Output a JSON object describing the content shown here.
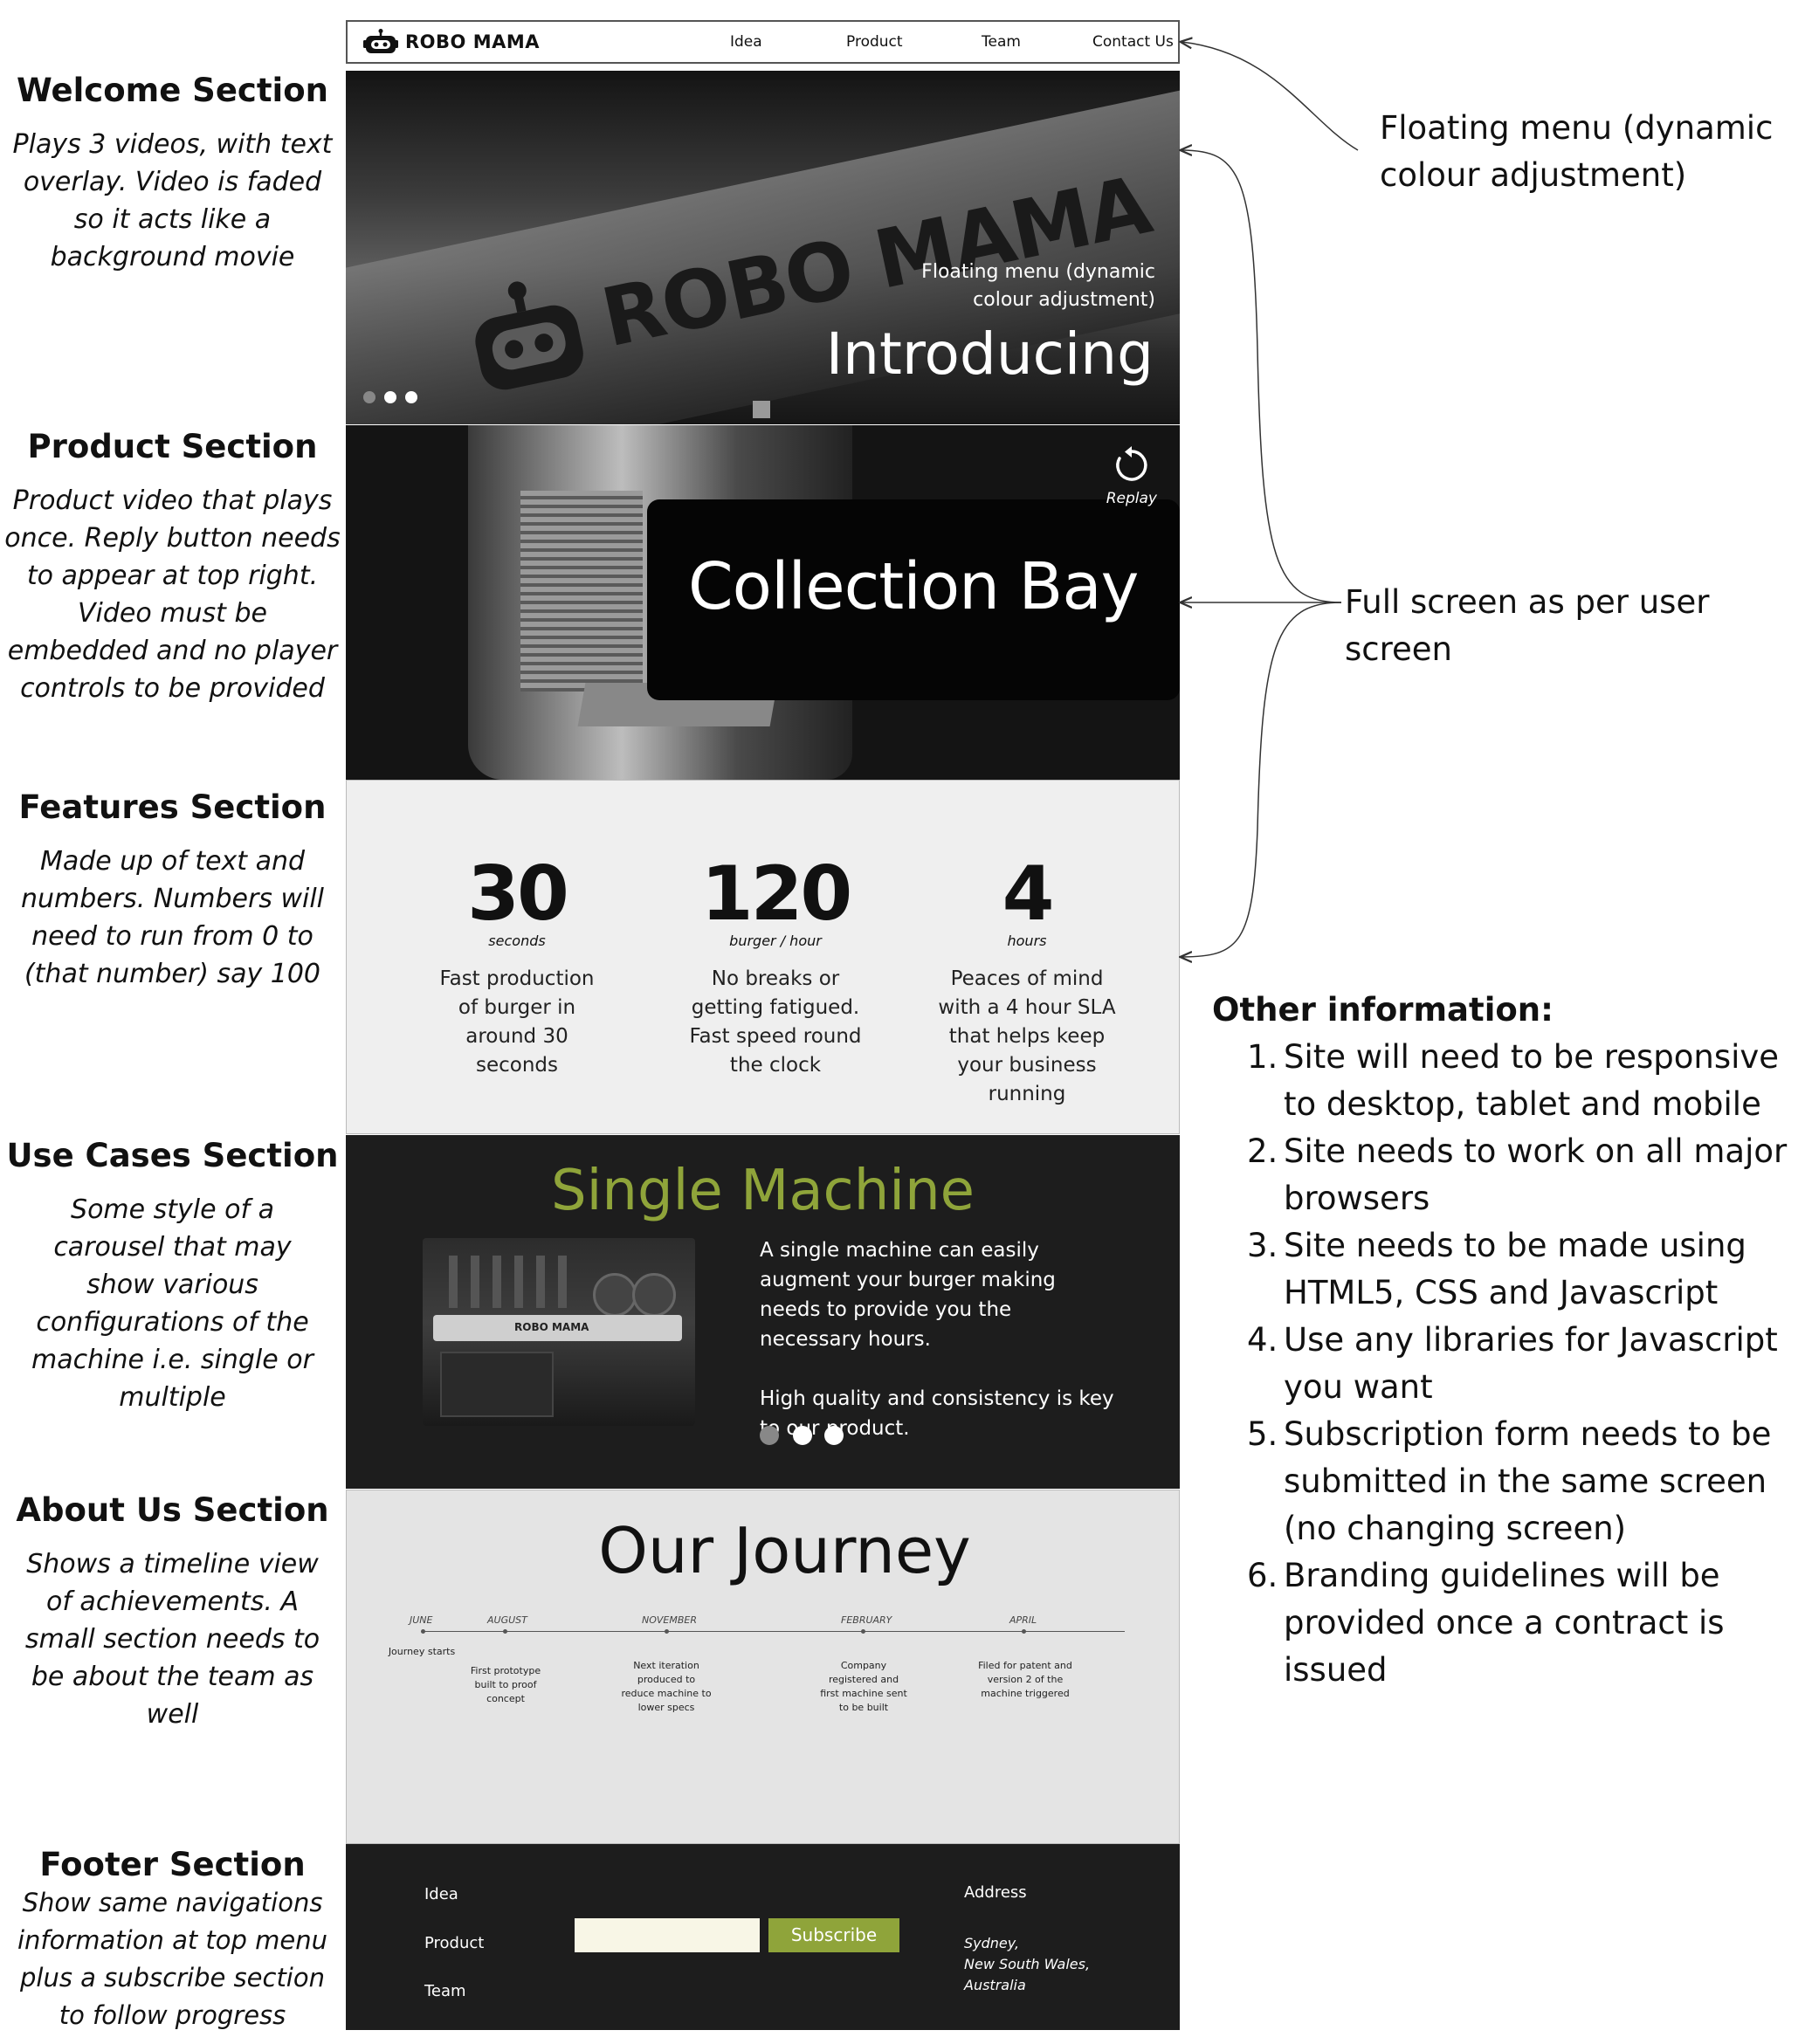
{
  "annotations": {
    "welcome": {
      "title": "Welcome Section",
      "desc": "Plays 3 videos, with text overlay. Video is faded so it acts like a background movie"
    },
    "product": {
      "title": "Product Section",
      "desc": "Product video that plays once. Reply button needs to appear at top right. Video must be embedded and no player controls to be provided"
    },
    "features": {
      "title": "Features Section",
      "desc": "Made up of text and numbers. Numbers will need to run from 0 to (that number) say 100"
    },
    "usecases": {
      "title": "Use Cases Section",
      "desc": "Some style of a carousel that may show various configurations of the machine i.e. single or multiple"
    },
    "about": {
      "title": "About Us Section",
      "desc": "Shows a timeline view of achievements. A small section needs to be about the team as well"
    },
    "footer": {
      "title": "Footer Section",
      "desc": "Show same navigations information at top menu plus a subscribe section to follow progress"
    }
  },
  "nav": {
    "logo_text": "ROBO MAMA",
    "items": [
      "Idea",
      "Product",
      "Team",
      "Contact Us"
    ]
  },
  "welcome": {
    "brand_text": "ROBO MAMA",
    "overlay_line1": "Floating menu (dynamic",
    "overlay_line2": "colour adjustment)",
    "headline": "Introducing",
    "dots_active": [
      false,
      true,
      true
    ]
  },
  "product": {
    "title": "Collection Bay",
    "replay_label": "Replay"
  },
  "features": [
    {
      "number": "30",
      "unit": "seconds",
      "desc": "Fast production of burger in around 30 seconds"
    },
    {
      "number": "120",
      "unit": "burger / hour",
      "desc": "No breaks or getting fatigued. Fast speed round the clock"
    },
    {
      "number": "4",
      "unit": "hours",
      "desc": "Peaces of mind with a 4 hour SLA that helps keep your business running"
    }
  ],
  "usecases": {
    "title": "Single Machine",
    "image_label": "ROBO MAMA",
    "para1": "A single machine can easily augment your burger making needs to provide you the necessary hours.",
    "para2": "High quality and consistency is key to our product.",
    "accent_color": "#8fa43a"
  },
  "about": {
    "title": "Our Journey",
    "timeline": [
      {
        "month": "JUNE",
        "text": "Journey starts"
      },
      {
        "month": "AUGUST",
        "text": "First prototype built to proof concept"
      },
      {
        "month": "NOVEMBER",
        "text": "Next iteration produced to reduce machine to lower specs"
      },
      {
        "month": "FEBRUARY",
        "text": "Company registered and first machine sent to be built"
      },
      {
        "month": "APRIL",
        "text": "Filed for patent and version 2 of the machine triggered"
      }
    ]
  },
  "footer": {
    "nav": [
      "Idea",
      "Product",
      "Team"
    ],
    "subscribe_label": "Subscribe",
    "input_placeholder": "",
    "address_heading": "Address",
    "address_lines": [
      "Sydney,",
      "New South Wales,",
      "Australia"
    ]
  },
  "right": {
    "floating_menu_1": "Floating menu (dynamic",
    "floating_menu_2": "colour adjustment)",
    "full_screen": "Full screen as per user screen",
    "other_title": "Other information:",
    "other_items": [
      "Site will need to be responsive to desktop, tablet and mobile",
      "Site needs to work on all major browsers",
      "Site needs to be made using HTML5, CSS and Javascript",
      "Use any libraries for Javascript you want",
      "Subscription form needs to be submitted in the same screen (no changing screen)",
      "Branding guidelines will be provided once a contract is issued"
    ]
  }
}
